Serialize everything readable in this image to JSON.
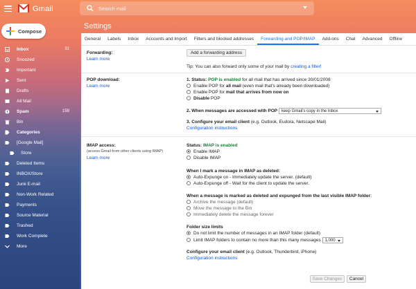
{
  "app": {
    "name": "Gmail"
  },
  "search": {
    "placeholder": "Search mail"
  },
  "compose": {
    "label": "Compose"
  },
  "sidebar": {
    "items": [
      {
        "label": "Inbox",
        "count": "31",
        "icon": "inbox-icon",
        "bold": true
      },
      {
        "label": "Snoozed",
        "icon": "clock-icon"
      },
      {
        "label": "Important",
        "icon": "important-icon"
      },
      {
        "label": "Sent",
        "icon": "send-icon"
      },
      {
        "label": "Drafts",
        "icon": "draft-icon"
      },
      {
        "label": "All Mail",
        "icon": "mail-icon"
      },
      {
        "label": "Spam",
        "count": "159",
        "icon": "spam-icon",
        "bold": true
      },
      {
        "label": "Bin",
        "icon": "trash-icon"
      },
      {
        "label": "Categories",
        "icon": "tag-icon",
        "bold": true
      },
      {
        "label": "[Google Mail]",
        "icon": "label-icon"
      },
      {
        "label": "Store",
        "icon": "label-icon",
        "sub": true
      },
      {
        "label": "Deleted Items",
        "icon": "label-icon"
      },
      {
        "label": "INBOX/Store",
        "icon": "label-icon"
      },
      {
        "label": "Junk E-mail",
        "icon": "label-icon"
      },
      {
        "label": "Non-Work Related",
        "icon": "label-icon"
      },
      {
        "label": "Payments",
        "icon": "label-icon"
      },
      {
        "label": "Source Material",
        "icon": "label-icon"
      },
      {
        "label": "Trashed",
        "icon": "label-icon"
      },
      {
        "label": "Work Complete",
        "icon": "label-icon"
      },
      {
        "label": "More",
        "icon": "chevron-down-icon"
      }
    ]
  },
  "settings": {
    "title": "Settings",
    "tabs": [
      "General",
      "Labels",
      "Inbox",
      "Accounts and Import",
      "Filters and blocked addresses",
      "Forwarding and POP/IMAP",
      "Add-ons",
      "Chat",
      "Advanced",
      "Offline"
    ],
    "active_tab": "Forwarding and POP/IMAP",
    "learn_more": "Learn more",
    "forwarding": {
      "label": "Forwarding:",
      "add_button": "Add a forwarding address",
      "tip_prefix": "Tip: You can also forward only some of your mail by ",
      "tip_link": "creating a filter!"
    },
    "pop": {
      "label": "POP download:",
      "status_prefix": "1. Status: ",
      "status_value": "POP is enabled",
      "status_suffix": " for all mail that has arrived since 30/01/2008",
      "opt1_prefix": "Enable POP for ",
      "opt1_bold": "all mail",
      "opt1_suffix": " (even mail that's already been downloaded)",
      "opt2_prefix": "Enable POP for ",
      "opt2_bold": "mail that arrives from now on",
      "opt3_prefix": "",
      "opt3_bold": "Disable",
      "opt3_suffix": " POP",
      "q2_label": "2. When messages are accessed with POP",
      "q2_value": "keep Gmail's copy in the Inbox",
      "q3_prefix": "3. Configure your email client",
      "q3_suffix": " (e.g. Outlook, Eudora, Netscape Mail)",
      "config_link": "Configuration instructions"
    },
    "imap": {
      "label": "IMAP access:",
      "sublabel": "(access Gmail from other clients using IMAP)",
      "status_prefix": "Status: ",
      "status_value": "IMAP is enabled",
      "enable": "Enable IMAP",
      "disable": "Disable IMAP",
      "deleted_heading": "When I mark a message in IMAP as deleted:",
      "expunge_on": "Auto-Expunge on - Immediately update the server. (default)",
      "expunge_off": "Auto-Expunge off - Wait for the client to update the server.",
      "expunged_heading": "When a message is marked as deleted and expunged from the last visible IMAP folder:",
      "archive": "Archive the message (default)",
      "move_bin": "Move the message to the Bin",
      "delete_forever": "Immediately delete the message forever",
      "folder_heading": "Folder size limits",
      "no_limit": "Do not limit the number of messages in an IMAP folder (default)",
      "limit_prefix": "Limit IMAP folders to contain no more than this many messages",
      "limit_value": "1,000",
      "client_heading": "Configure your email client",
      "client_suffix": " (e.g. Outlook, Thunderbird, iPhone)",
      "config_link": "Configuration instructions"
    },
    "save_button": "Save Changes",
    "cancel_button": "Cancel"
  }
}
